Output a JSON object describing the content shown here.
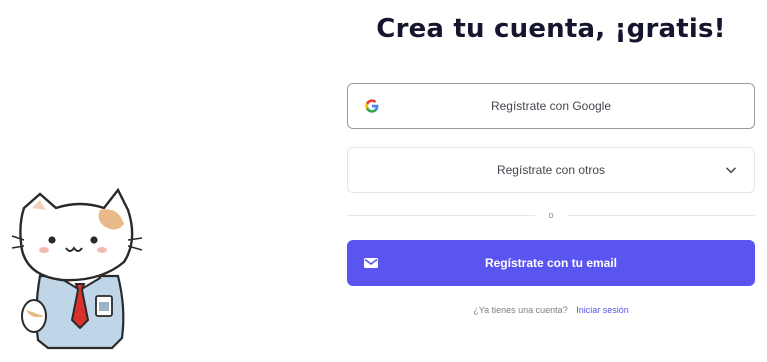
{
  "signup": {
    "title": "Crea tu cuenta, ¡gratis!",
    "google_button": {
      "label": "Regístrate con Google",
      "icon": "google-icon"
    },
    "other_button": {
      "label": "Regístrate con otros",
      "icon": "chevron-down-icon"
    },
    "divider_text": "o",
    "email_button": {
      "label": "Regístrate con tu email",
      "icon": "mail-icon",
      "color": "#5a55f0"
    },
    "footer": {
      "question": "¿Ya tienes una cuenta?",
      "login_link": "Iniciar sesión"
    }
  },
  "colors": {
    "accent": "#5a55f0",
    "title": "#15152e"
  }
}
